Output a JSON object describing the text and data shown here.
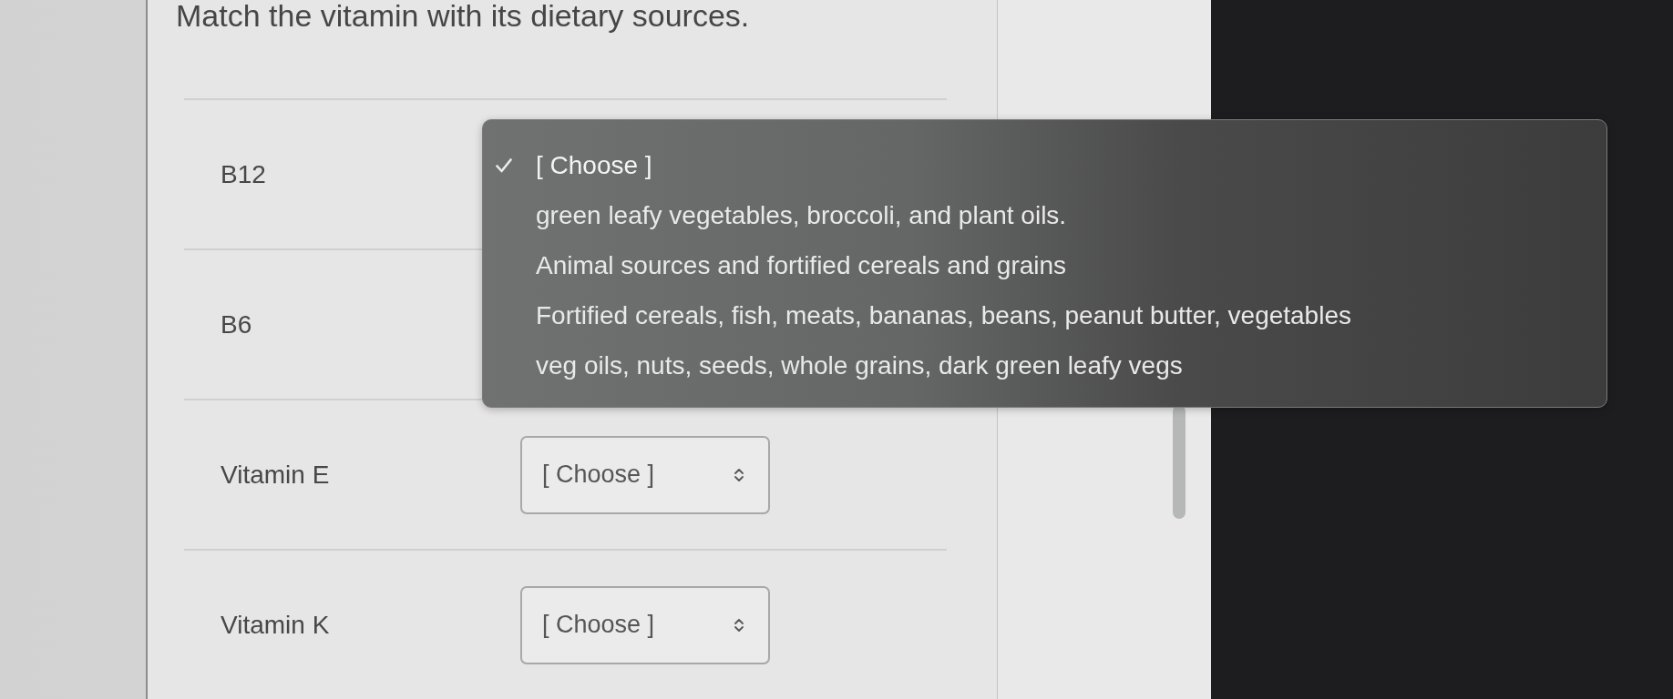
{
  "question": {
    "text": "Match the vitamin with its dietary sources."
  },
  "rows": [
    {
      "label": "B12",
      "dropdown": {
        "open": true,
        "options": [
          {
            "text": "[ Choose ]",
            "selected": true
          },
          {
            "text": "green leafy vegetables, broccoli, and plant oils.",
            "selected": false
          },
          {
            "text": "Animal sources and fortified cereals and grains",
            "selected": false
          },
          {
            "text": "Fortified cereals, fish, meats, bananas, beans, peanut butter, vegetables",
            "selected": false
          },
          {
            "text": "veg oils, nuts, seeds, whole grains, dark green leafy vegs",
            "selected": false
          }
        ]
      }
    },
    {
      "label": "B6"
    },
    {
      "label": "Vitamin E",
      "dropdown": {
        "open": false,
        "value": "[ Choose ]"
      }
    },
    {
      "label": "Vitamin K",
      "dropdown": {
        "open": false,
        "value": "[ Choose ]"
      }
    }
  ]
}
